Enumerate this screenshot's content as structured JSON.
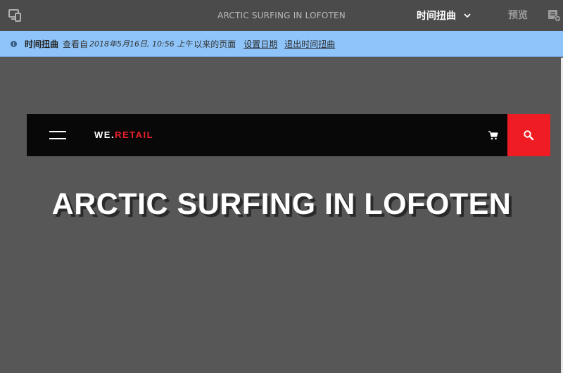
{
  "toolbar": {
    "page_title": "ARCTIC SURFING IN LOFOTEN",
    "mode_label": "时间扭曲",
    "preview_label": "预览",
    "icons": {
      "device": "device-emulator-icon",
      "chevron": "chevron-down-icon",
      "annotate": "annotate-icon"
    }
  },
  "infobar": {
    "title": "时间扭曲",
    "text_prefix": "查看自",
    "date": "2018年5月16日, 10:56 上午",
    "text_suffix": "以来的页面",
    "set_date_link": "设置日期",
    "exit_link": "退出时间扭曲",
    "icon": "info-icon",
    "background": "#8ec4f9"
  },
  "site": {
    "logo_prefix": "WE.",
    "logo_suffix": "RETAIL",
    "logo_accent_color": "#e8202a",
    "search_color": "#ef1c24",
    "hero_title": "ARCTIC SURFING IN LOFOTEN",
    "icons": {
      "menu": "hamburger-menu-icon",
      "cart": "cart-icon",
      "search": "search-icon"
    }
  }
}
